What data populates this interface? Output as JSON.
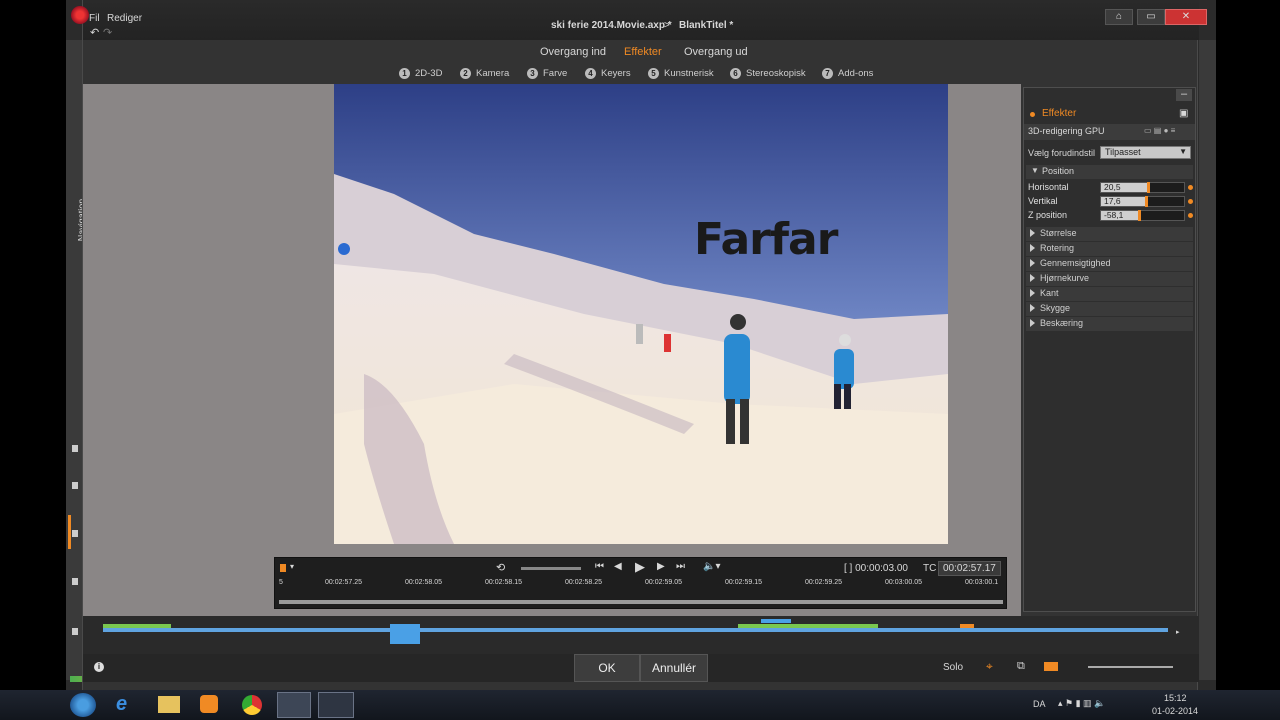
{
  "window": {
    "menu": [
      "Fil",
      "Rediger"
    ],
    "project": "ski ferie 2014.Movie.axp *",
    "breadcrumb_sep": ">",
    "title_item": "BlankTitel *",
    "cart_icon": "cart-icon",
    "min_icon": "minimize-icon",
    "max_icon": "maximize-icon",
    "close_icon": "close-icon"
  },
  "sidebar": {
    "navigation_label": "Navigation"
  },
  "tabs": [
    {
      "label": "Overgang ind",
      "active": false
    },
    {
      "label": "Effekter",
      "active": true
    },
    {
      "label": "Overgang ud",
      "active": false
    }
  ],
  "categories": [
    {
      "num": "1",
      "label": "2D-3D"
    },
    {
      "num": "2",
      "label": "Kamera"
    },
    {
      "num": "3",
      "label": "Farve"
    },
    {
      "num": "4",
      "label": "Keyers"
    },
    {
      "num": "5",
      "label": "Kunstnerisk"
    },
    {
      "num": "6",
      "label": "Stereoskopisk"
    },
    {
      "num": "7",
      "label": "Add-ons"
    }
  ],
  "preview": {
    "overlay_text": "Farfar"
  },
  "player": {
    "duration": "[ ] 00:00:03.00",
    "tc_label": "TC",
    "timecode": "00:02:57.17",
    "ruler": [
      "00:02:57.25",
      "00:02:58.05",
      "00:02:58.15",
      "00:02:58.25",
      "00:02:59.05",
      "00:02:59.15",
      "00:02:59.25",
      "00:03:00.05",
      "00:03:00.1"
    ],
    "ruler_start": "5"
  },
  "panel": {
    "header": "Effekter",
    "effect_name": "3D-redigering GPU",
    "preset_label": "Vælg forudindstil",
    "preset_value": "Tilpasset",
    "position_section": "Position",
    "sliders": [
      {
        "label": "Horisontal",
        "value": "20,5",
        "fraction": 0.55
      },
      {
        "label": "Vertikal",
        "value": "17,6",
        "fraction": 0.53
      },
      {
        "label": "Z position",
        "value": "-58,1",
        "fraction": 0.45
      }
    ],
    "sections": [
      "Størrelse",
      "Rotering",
      "Gennemsigtighed",
      "Hjørnekurve",
      "Kant",
      "Skygge",
      "Beskæring"
    ],
    "accent": "#f08a24"
  },
  "bottom": {
    "ok": "OK",
    "cancel": "Annullér",
    "solo": "Solo"
  },
  "taskbar": {
    "lang": "DA",
    "time": "15:12",
    "date": "01-02-2014"
  }
}
